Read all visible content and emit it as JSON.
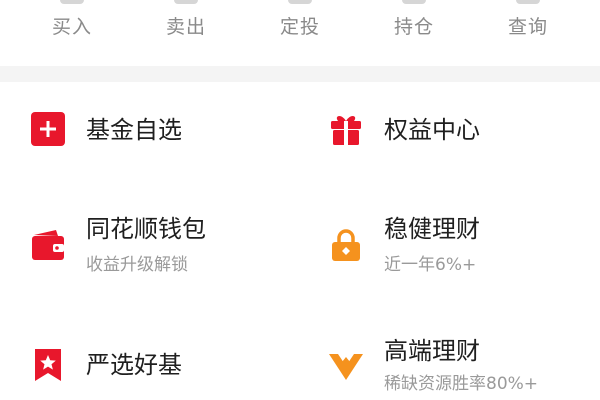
{
  "quick_actions": [
    {
      "label": "买入",
      "icon": "buy-icon"
    },
    {
      "label": "卖出",
      "icon": "sell-icon"
    },
    {
      "label": "定投",
      "icon": "auto-invest-icon"
    },
    {
      "label": "持仓",
      "icon": "holdings-icon"
    },
    {
      "label": "查询",
      "icon": "query-icon"
    }
  ],
  "services": [
    {
      "title": "基金自选",
      "subtitle": "",
      "icon": "plus-square-icon",
      "color": "#e8172c"
    },
    {
      "title": "权益中心",
      "subtitle": "",
      "icon": "gift-icon",
      "color": "#e8172c"
    },
    {
      "title": "同花顺钱包",
      "subtitle": "收益升级解锁",
      "icon": "wallet-icon",
      "color": "#e8172c"
    },
    {
      "title": "稳健理财",
      "subtitle": "近一年6%+",
      "icon": "lock-icon",
      "color": "#f5921e"
    },
    {
      "title": "严选好基",
      "subtitle": "",
      "icon": "bookmark-star-icon",
      "color": "#e8172c"
    },
    {
      "title": "高端理财",
      "subtitle": "稀缺资源胜率80%+",
      "icon": "v-diamond-icon",
      "color": "#f5921e"
    }
  ],
  "colors": {
    "accent_red": "#e8172c",
    "accent_orange": "#f5921e",
    "text_primary": "#1f1f1f",
    "text_secondary": "#9a9a9a",
    "band_gray": "#f4f4f4"
  }
}
